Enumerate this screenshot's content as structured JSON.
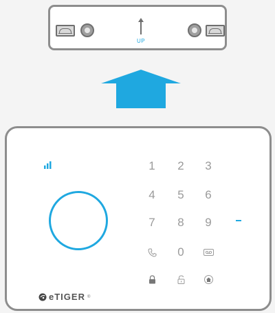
{
  "bracket": {
    "up_label": "UP"
  },
  "keypad": {
    "keys": [
      "1",
      "2",
      "3",
      "4",
      "5",
      "6",
      "7",
      "8",
      "9",
      "0"
    ],
    "icons": [
      "phone-icon",
      "tape-icon",
      "arm-away-icon",
      "disarm-icon",
      "home-arm-icon"
    ]
  },
  "brand": {
    "name": "eTIGER",
    "reg": "®"
  },
  "colors": {
    "accent": "#1fa8e0",
    "outline": "#8d8d8d",
    "key_text": "#9a9a9a"
  }
}
